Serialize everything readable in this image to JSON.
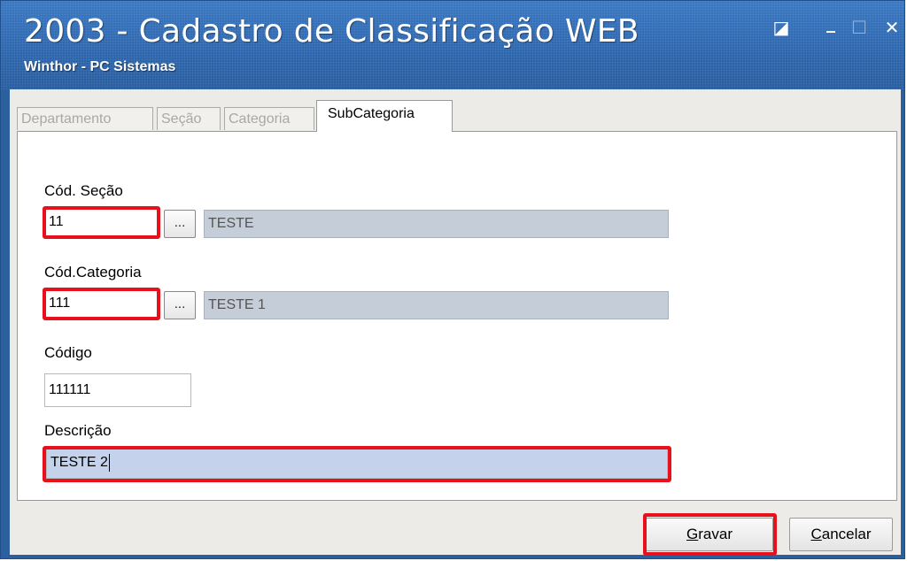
{
  "window": {
    "title": "2003 - Cadastro de Classificação WEB",
    "subtitle": "Winthor - PC Sistemas",
    "controls": {
      "restore": "◪",
      "minimize": "_",
      "maximize": "☐",
      "close": "✕"
    }
  },
  "tabs": [
    {
      "label": "Departamento",
      "active": false
    },
    {
      "label": "Seção",
      "active": false
    },
    {
      "label": "Categoria",
      "active": false
    },
    {
      "label": "SubCategoria",
      "active": true
    }
  ],
  "form": {
    "cod_secao": {
      "label": "Cód. Seção",
      "value": "11",
      "lookup_button": "...",
      "description": "TESTE"
    },
    "cod_categoria": {
      "label": "Cód.Categoria",
      "value": "111",
      "lookup_button": "...",
      "description": "TESTE 1"
    },
    "codigo": {
      "label": "Código",
      "value": "111111"
    },
    "descricao": {
      "label": "Descrição",
      "value": "TESTE 2"
    }
  },
  "buttons": {
    "gravar": "Gravar",
    "cancelar": "Cancelar"
  },
  "colors": {
    "titlebar": "#2f6ab0",
    "highlight": "#e8101a",
    "readonly_field": "#c5ced8",
    "selected_field": "#c4d2ec"
  }
}
